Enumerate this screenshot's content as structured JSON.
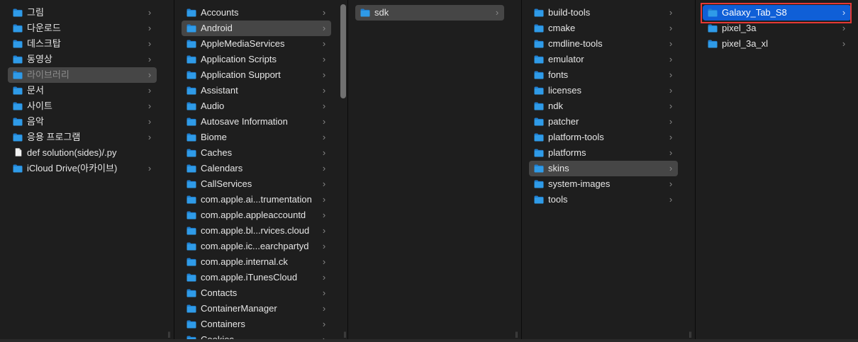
{
  "colors": {
    "background": "#1e1e1e",
    "folder": "#2f9be8",
    "selection_gray": "#464646",
    "selection_blue": "#0f5fd7",
    "highlight_outline": "#e53935"
  },
  "columns": [
    {
      "items": [
        {
          "label": "그림",
          "icon": "photos-folder-icon",
          "chevron": true
        },
        {
          "label": "다운로드",
          "icon": "downloads-folder-icon",
          "chevron": true
        },
        {
          "label": "데스크탑",
          "icon": "desktop-folder-icon",
          "chevron": true
        },
        {
          "label": "동영상",
          "icon": "movies-folder-icon",
          "chevron": true
        },
        {
          "label": "라이브러리",
          "icon": "library-folder-icon",
          "chevron": true,
          "selected": true
        },
        {
          "label": "문서",
          "icon": "documents-folder-icon",
          "chevron": true
        },
        {
          "label": "사이트",
          "icon": "sites-folder-icon",
          "chevron": true
        },
        {
          "label": "음악",
          "icon": "music-folder-icon",
          "chevron": true
        },
        {
          "label": "응용 프로그램",
          "icon": "applications-folder-icon",
          "chevron": true
        },
        {
          "label": "def solution(sides)/.py",
          "icon": "file-icon",
          "chevron": false
        },
        {
          "label": "iCloud Drive(아카이브)",
          "icon": "folder-icon",
          "chevron": true
        }
      ]
    },
    {
      "items": [
        {
          "label": "Accounts",
          "chevron": true
        },
        {
          "label": "Android",
          "chevron": true,
          "selected": true
        },
        {
          "label": "AppleMediaServices",
          "chevron": true
        },
        {
          "label": "Application Scripts",
          "chevron": true
        },
        {
          "label": "Application Support",
          "chevron": true
        },
        {
          "label": "Assistant",
          "chevron": true
        },
        {
          "label": "Audio",
          "chevron": true
        },
        {
          "label": "Autosave Information",
          "chevron": true
        },
        {
          "label": "Biome",
          "chevron": true
        },
        {
          "label": "Caches",
          "chevron": true
        },
        {
          "label": "Calendars",
          "chevron": true
        },
        {
          "label": "CallServices",
          "chevron": true
        },
        {
          "label": "com.apple.ai...trumentation",
          "chevron": true
        },
        {
          "label": "com.apple.appleaccountd",
          "chevron": true
        },
        {
          "label": "com.apple.bl...rvices.cloud",
          "chevron": true
        },
        {
          "label": "com.apple.ic...earchpartyd",
          "chevron": true
        },
        {
          "label": "com.apple.internal.ck",
          "chevron": true
        },
        {
          "label": "com.apple.iTunesCloud",
          "chevron": true
        },
        {
          "label": "Contacts",
          "chevron": true
        },
        {
          "label": "ContainerManager",
          "chevron": true
        },
        {
          "label": "Containers",
          "chevron": true
        },
        {
          "label": "Cookies",
          "chevron": true
        }
      ]
    },
    {
      "items": [
        {
          "label": "sdk",
          "chevron": true,
          "selected": true
        }
      ]
    },
    {
      "items": [
        {
          "label": "build-tools",
          "chevron": true
        },
        {
          "label": "cmake",
          "chevron": true
        },
        {
          "label": "cmdline-tools",
          "chevron": true
        },
        {
          "label": "emulator",
          "chevron": true
        },
        {
          "label": "fonts",
          "chevron": true
        },
        {
          "label": "licenses",
          "chevron": true
        },
        {
          "label": "ndk",
          "chevron": true
        },
        {
          "label": "patcher",
          "chevron": true
        },
        {
          "label": "platform-tools",
          "chevron": true
        },
        {
          "label": "platforms",
          "chevron": true
        },
        {
          "label": "skins",
          "chevron": true,
          "selected": true
        },
        {
          "label": "system-images",
          "chevron": true
        },
        {
          "label": "tools",
          "chevron": true
        }
      ]
    },
    {
      "items": [
        {
          "label": "Galaxy_Tab_S8",
          "chevron": true,
          "active": true
        },
        {
          "label": "pixel_3a",
          "chevron": true
        },
        {
          "label": "pixel_3a_xl",
          "chevron": true
        }
      ]
    }
  ],
  "icons": {
    "chevron": "›",
    "resize_handle": "||"
  }
}
